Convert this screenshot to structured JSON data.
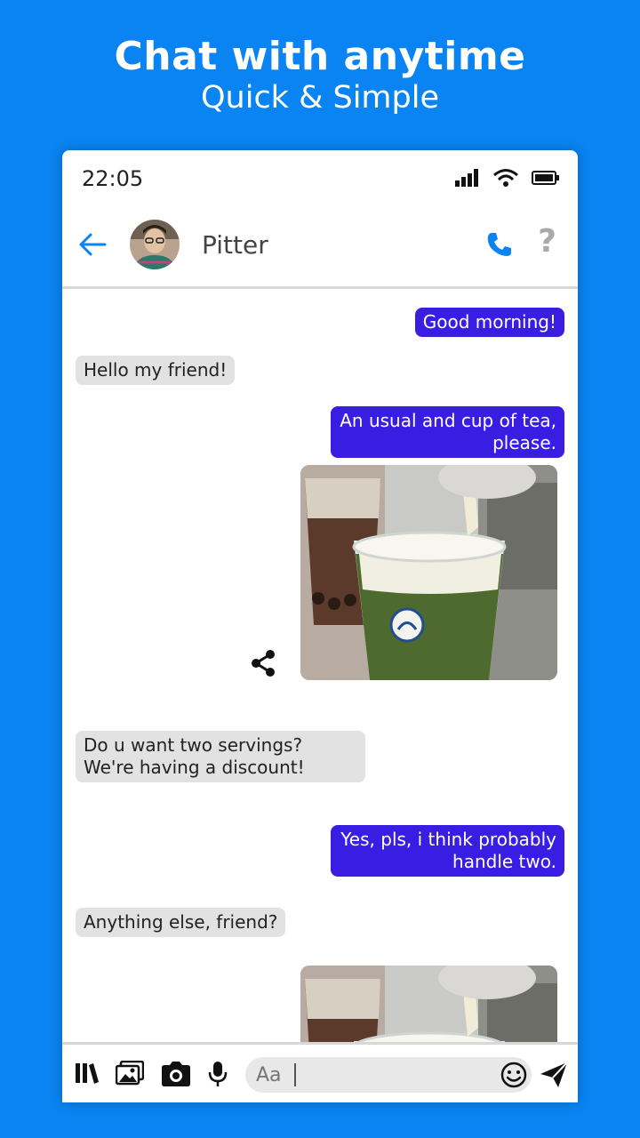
{
  "promo": {
    "title": "Chat with anytime",
    "subtitle": "Quick & Simple",
    "background_color": "#0a84f2"
  },
  "status_bar": {
    "time": "22:05",
    "icons": [
      "cellular-signal-icon",
      "wifi-icon",
      "battery-icon"
    ]
  },
  "header": {
    "back_icon": "arrow-left-icon",
    "contact_name": "Pitter",
    "call_icon": "phone-icon",
    "help_icon": "question-mark-icon",
    "help_glyph": "?"
  },
  "messages": [
    {
      "direction": "outgoing",
      "text": "Good morning!"
    },
    {
      "direction": "incoming",
      "text": "Hello my friend!"
    },
    {
      "direction": "outgoing",
      "text": "An usual and cup of tea, please."
    },
    {
      "direction": "outgoing",
      "type": "image",
      "content": "photo of iced matcha cheese tea being poured",
      "share_icon": "share-icon"
    },
    {
      "direction": "incoming",
      "text": "Do u want two servings? We're having a discount!"
    },
    {
      "direction": "outgoing",
      "text": "Yes, pls, i think probably handle two."
    },
    {
      "direction": "incoming",
      "text": "Anything else, friend?"
    },
    {
      "direction": "outgoing",
      "type": "image",
      "content": "photo of iced matcha cheese tea being poured"
    }
  ],
  "composer": {
    "tools": [
      "library-icon",
      "gallery-icon",
      "camera-icon",
      "microphone-icon"
    ],
    "input_placeholder": "Aa",
    "emoji_icon": "smiley-icon",
    "send_icon": "send-icon"
  },
  "colors": {
    "accent": "#0a84f2",
    "outgoing_bubble": "#3a1de3",
    "incoming_bubble": "#e2e2e2"
  }
}
